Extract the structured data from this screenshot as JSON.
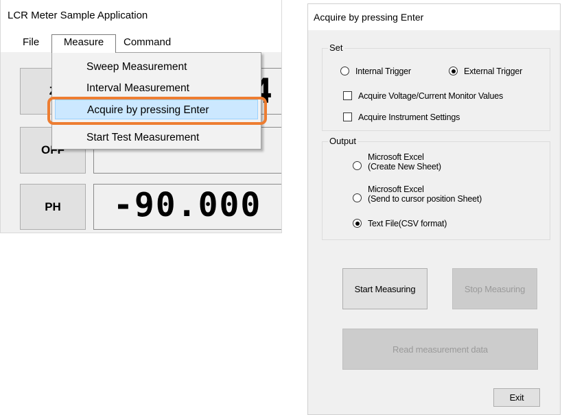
{
  "main_window": {
    "title": "LCR Meter Sample Application",
    "menu": {
      "file": "File",
      "measure": "Measure",
      "command": "Command"
    },
    "dropdown": {
      "sweep": "Sweep Measurement",
      "interval": "Interval Measurement",
      "enter": "Acquire by pressing Enter",
      "test": "Start Test Measurement"
    },
    "params": {
      "btn1": "Z",
      "btn2": "OFF",
      "btn3": "PH",
      "value1": "4",
      "value2": "",
      "value3": "-90.000"
    }
  },
  "dialog": {
    "title": "Acquire by pressing Enter",
    "set": {
      "title": "Set",
      "internal_trigger": "Internal Trigger",
      "external_trigger": "External Trigger",
      "acquire_monitor": "Acquire Voltage/Current Monitor Values",
      "acquire_settings": "Acquire Instrument Settings"
    },
    "output": {
      "title": "Output",
      "excel_new_l1": "Microsoft Excel",
      "excel_new_l2": "(Create New Sheet)",
      "excel_cursor_l1": "Microsoft Excel",
      "excel_cursor_l2": "(Send to cursor position Sheet)",
      "text_file": "Text File(CSV format)"
    },
    "buttons": {
      "start": "Start Measuring",
      "stop": "Stop Measuring",
      "read": "Read measurement data",
      "exit": "Exit"
    }
  },
  "colors": {
    "highlight": "#ed7d31",
    "selected_item": "#cce8ff"
  }
}
